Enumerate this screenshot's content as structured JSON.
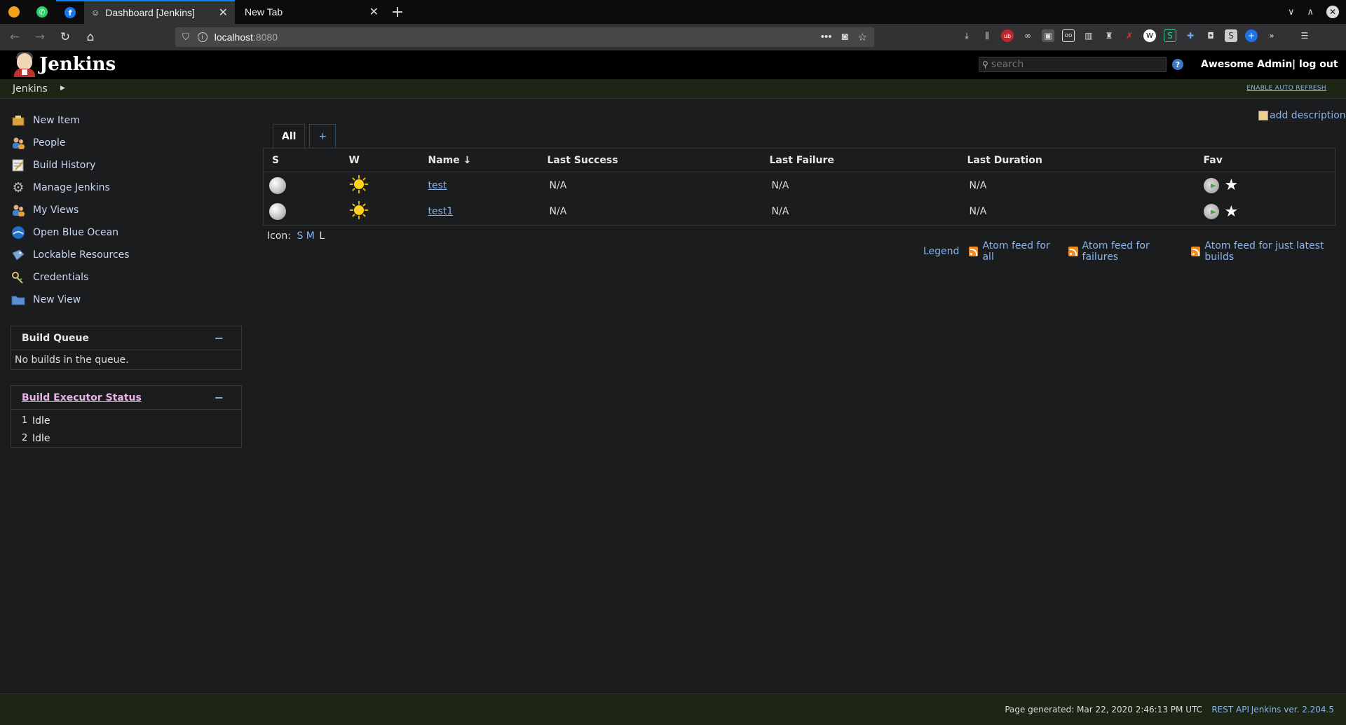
{
  "browser": {
    "tabs": [
      {
        "title": "Dashboard [Jenkins]",
        "active": true
      },
      {
        "title": "New Tab",
        "active": false
      }
    ],
    "url_host": "localhost",
    "url_port": ":8080"
  },
  "header": {
    "logo_text": "Jenkins",
    "search_placeholder": "search",
    "help": "?",
    "user": "Awesome Admin",
    "logout": "| log out"
  },
  "breadcrumb": {
    "root": "Jenkins",
    "auto_refresh": "ENABLE AUTO REFRESH"
  },
  "sidebar": {
    "items": [
      {
        "label": "New Item",
        "icon": "new-item-icon"
      },
      {
        "label": "People",
        "icon": "people-icon"
      },
      {
        "label": "Build History",
        "icon": "build-history-icon"
      },
      {
        "label": "Manage Jenkins",
        "icon": "gear-icon"
      },
      {
        "label": "My Views",
        "icon": "my-views-icon"
      },
      {
        "label": "Open Blue Ocean",
        "icon": "blue-ocean-icon"
      },
      {
        "label": "Lockable Resources",
        "icon": "lock-icon"
      },
      {
        "label": "Credentials",
        "icon": "key-icon"
      },
      {
        "label": "New View",
        "icon": "folder-icon"
      }
    ]
  },
  "build_queue": {
    "title": "Build Queue",
    "collapse": "−",
    "empty": "No builds in the queue."
  },
  "executors": {
    "title": "Build Executor Status",
    "collapse": "−",
    "rows": [
      {
        "num": "1",
        "status": "Idle"
      },
      {
        "num": "2",
        "status": "Idle"
      }
    ]
  },
  "main": {
    "add_description": "add description",
    "tabs": [
      "All",
      "+"
    ],
    "columns": [
      "S",
      "W",
      "Name ↓",
      "Last Success",
      "Last Failure",
      "Last Duration",
      "Fav"
    ],
    "jobs": [
      {
        "name": "test",
        "last_success": "N/A",
        "last_failure": "N/A",
        "last_duration": "N/A"
      },
      {
        "name": "test1",
        "last_success": "N/A",
        "last_failure": "N/A",
        "last_duration": "N/A"
      }
    ],
    "icon_label": "Icon:",
    "icon_sizes": [
      "S",
      "M",
      "L"
    ],
    "legend": "Legend",
    "feeds": [
      "Atom feed for all",
      "Atom feed for failures",
      "Atom feed for just latest builds"
    ]
  },
  "footer": {
    "generated": "Page generated: Mar 22, 2020 2:46:13 PM UTC",
    "rest_api": "REST API",
    "version": "Jenkins ver. 2.204.5"
  },
  "colors": {
    "accent": "#0a84ff",
    "link": "#8ab4e8",
    "header_bg": "#000000",
    "breadcrumb_bg": "#1d2514"
  }
}
